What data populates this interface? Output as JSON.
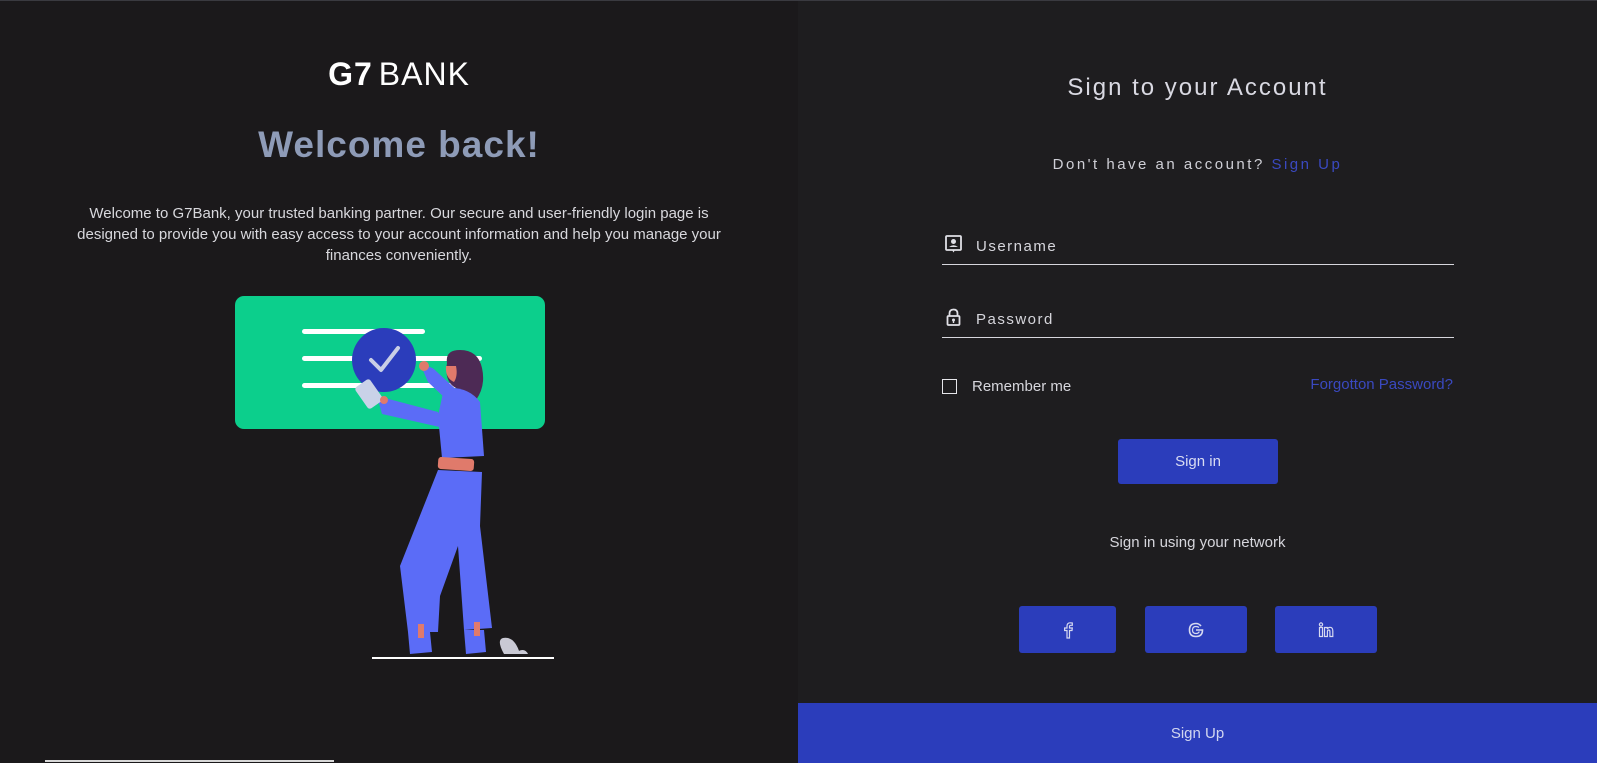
{
  "left": {
    "logo_bold": "G7",
    "logo_light": "BANK",
    "welcome": "Welcome back!",
    "intro": "Welcome to G7Bank, your trusted banking partner. Our secure and user-friendly login page is designed to provide you with easy access to your account information and help you manage your finances conveniently."
  },
  "form": {
    "title": "Sign to your Account",
    "no_account_text": "Don't have an account?",
    "signup_link": "Sign Up",
    "username_placeholder": "Username",
    "password_placeholder": "Password",
    "remember_label": "Remember me",
    "forgot_link": "Forgotton Password?",
    "signin_button": "Sign in",
    "network_text": "Sign in using your network",
    "signup_button": "Sign Up",
    "social": [
      "facebook-icon",
      "google-icon",
      "linkedin-icon"
    ]
  },
  "colors": {
    "accent": "#2b3dbb",
    "link": "#3a49c0",
    "background": "#1b191b",
    "welcome": "#8e9bb7",
    "illustration_card": "#0ccf8c",
    "illustration_figure": "#5b6cf7"
  }
}
